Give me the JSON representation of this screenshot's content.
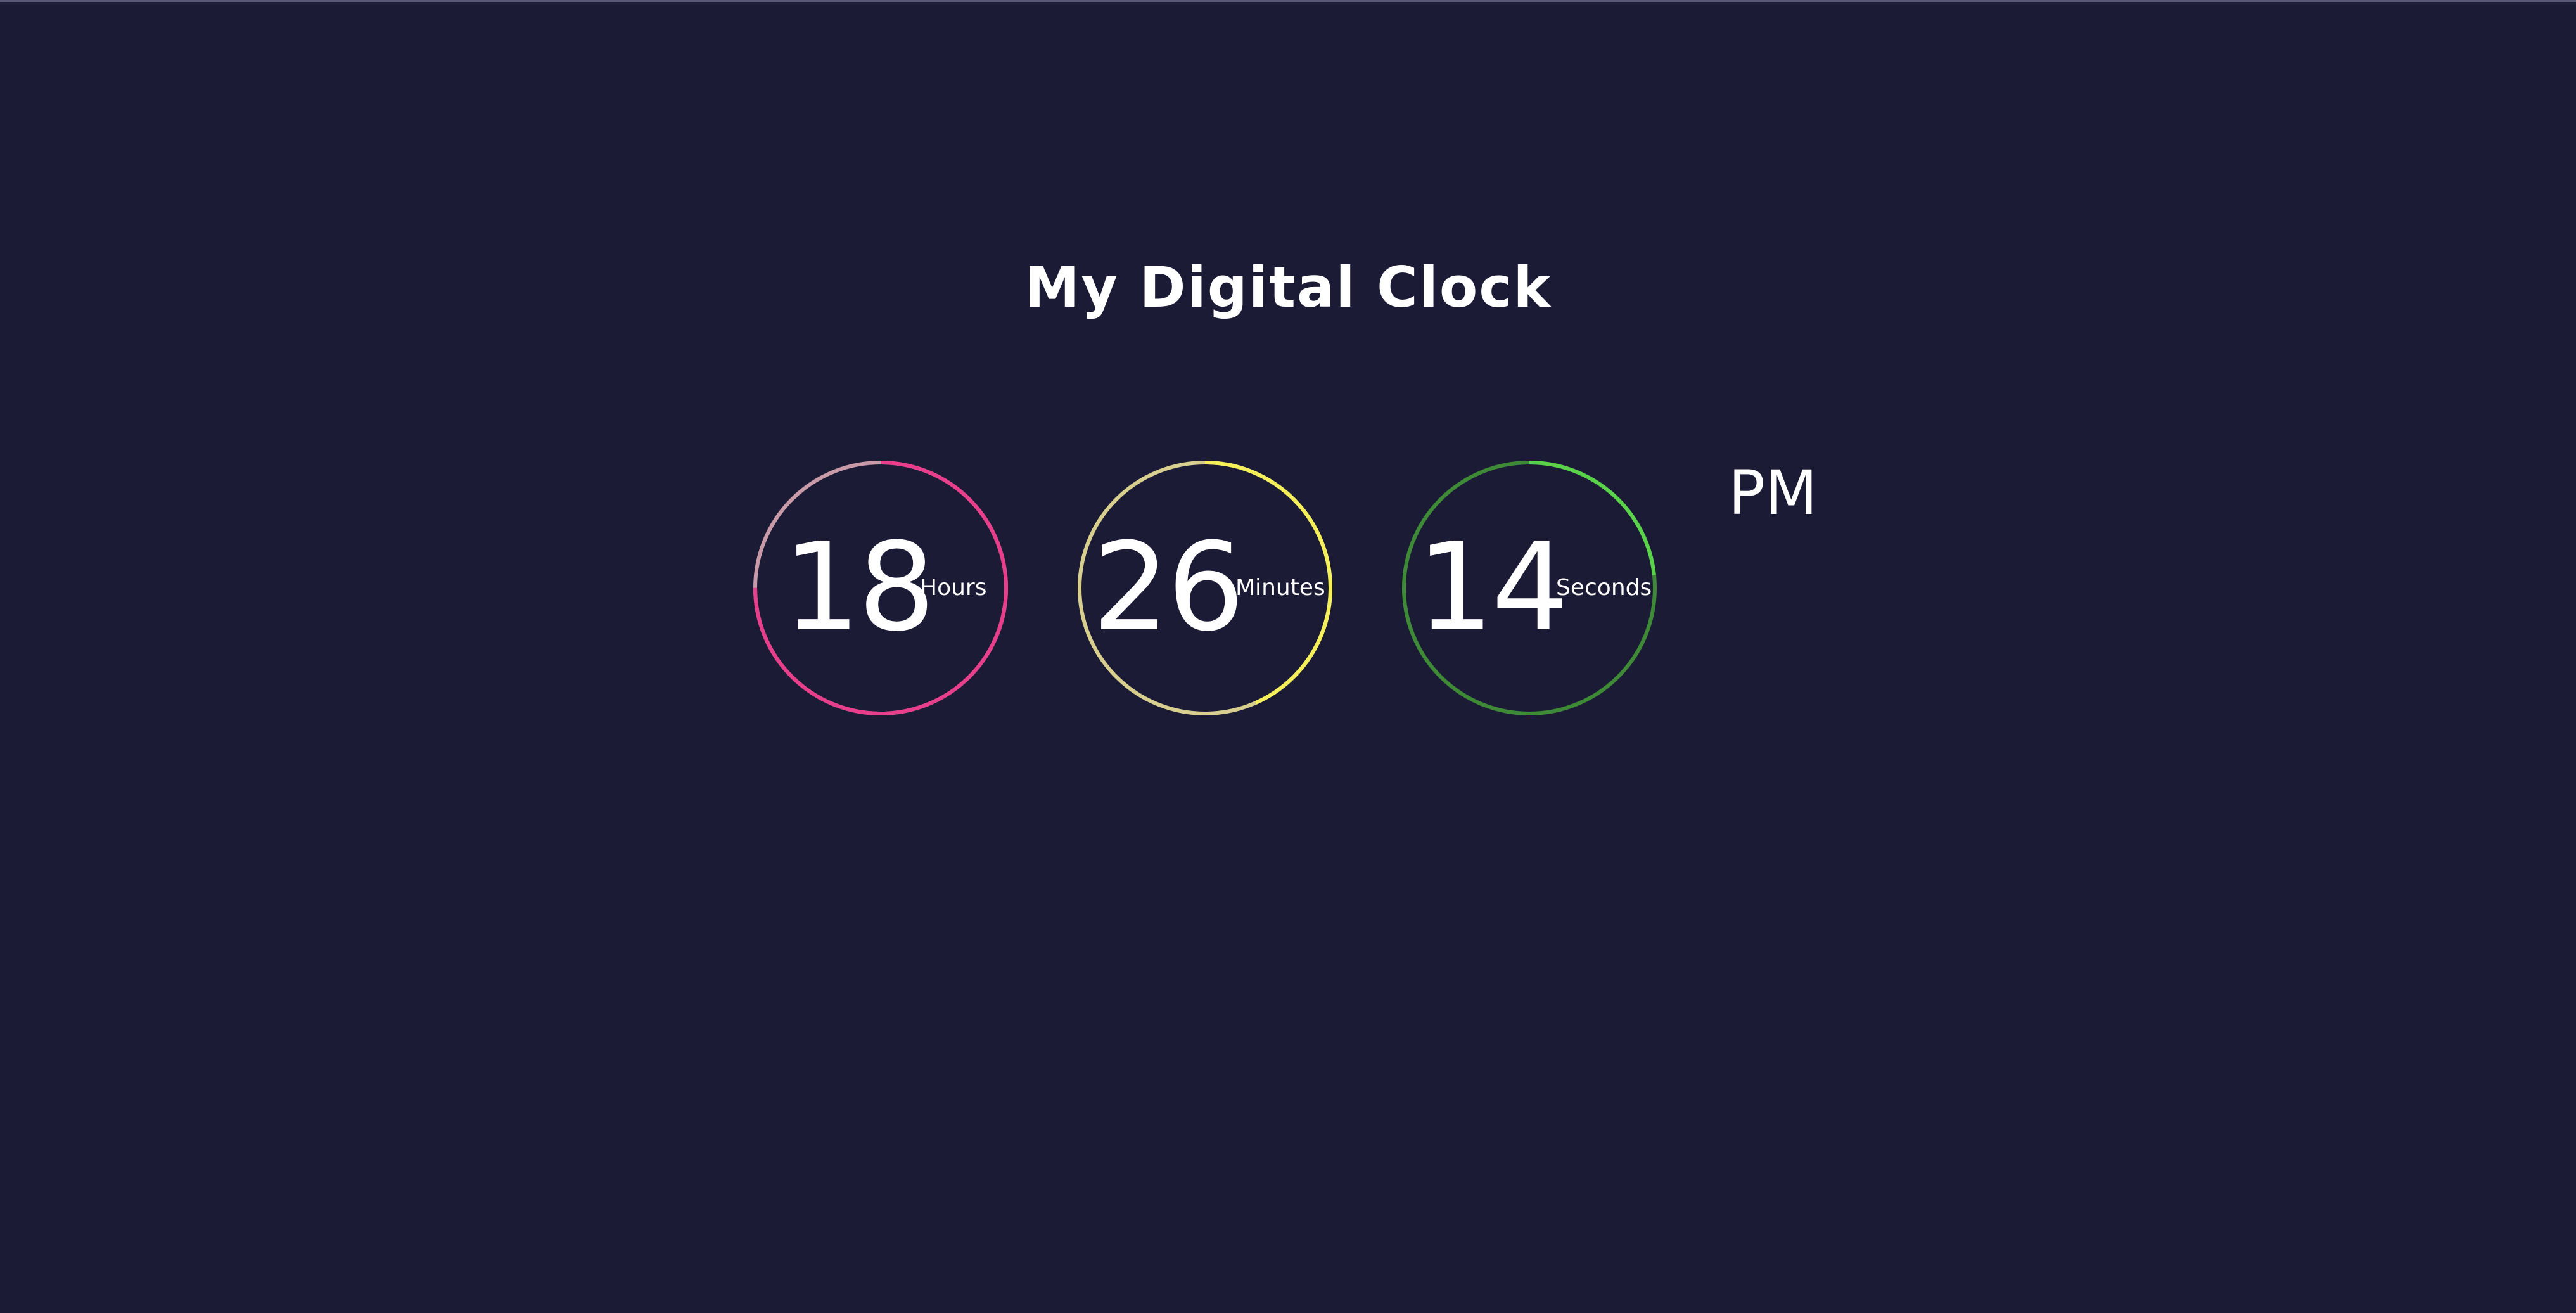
{
  "title": "My Digital Clock",
  "clock": {
    "hours": {
      "value": "18",
      "unit": "Hours",
      "fraction": 0.75,
      "color": "#e83e8c",
      "track": "#c99aa8"
    },
    "minutes": {
      "value": "26",
      "unit": "Minutes",
      "fraction": 0.4333,
      "color": "#f5f05a",
      "track": "#d8cf8f"
    },
    "seconds": {
      "value": "14",
      "unit": "Seconds",
      "fraction": 0.2333,
      "color": "#5ad34a",
      "track": "#3f8a36"
    },
    "ampm": "PM"
  },
  "colors": {
    "background": "#1b1b36",
    "text": "#ffffff"
  }
}
